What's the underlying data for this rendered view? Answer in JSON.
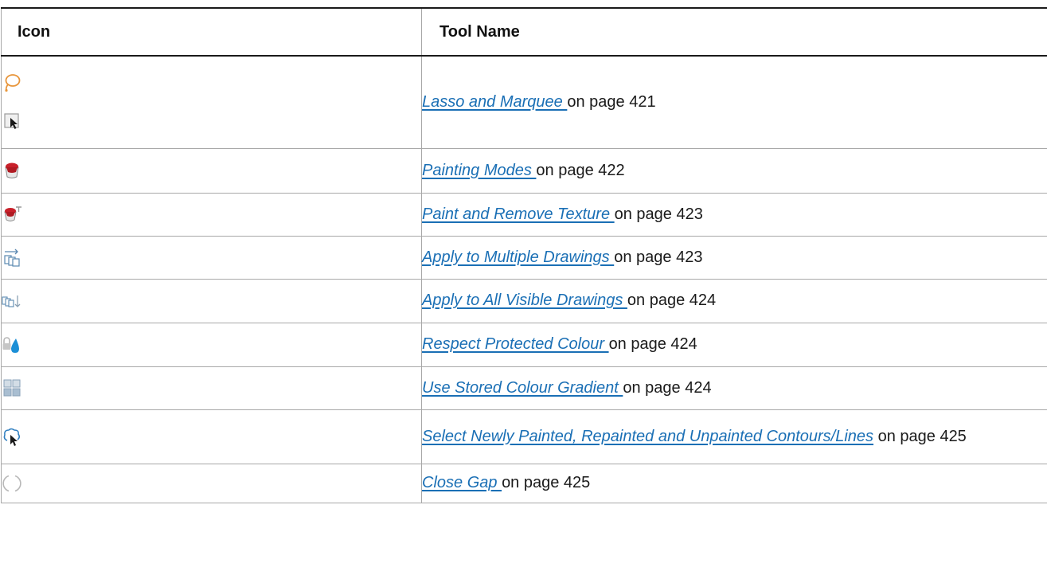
{
  "table": {
    "headers": {
      "icon": "Icon",
      "tool_name": "Tool Name"
    },
    "rows": [
      {
        "icons": [
          "lasso-icon",
          "marquee-icon"
        ],
        "link": "Lasso and Marquee ",
        "suffix": " on page 421"
      },
      {
        "icons": [
          "paint-bucket-icon"
        ],
        "link": "Painting Modes ",
        "suffix": " on page 422"
      },
      {
        "icons": [
          "paint-texture-icon"
        ],
        "link": "Paint and Remove Texture ",
        "suffix": " on page 423"
      },
      {
        "icons": [
          "apply-multiple-drawings-icon"
        ],
        "link": "Apply to Multiple Drawings ",
        "suffix": " on page 423"
      },
      {
        "icons": [
          "apply-all-visible-drawings-icon"
        ],
        "link": "Apply to All Visible Drawings ",
        "suffix": " on page 424"
      },
      {
        "icons": [
          "protected-colour-icon"
        ],
        "link": "Respect Protected Colour ",
        "suffix": " on page 424"
      },
      {
        "icons": [
          "stored-gradient-icon"
        ],
        "link": "Use Stored Colour Gradient ",
        "suffix": " on page 424"
      },
      {
        "icons": [
          "select-painted-contours-icon"
        ],
        "link": "Select Newly Painted, Repainted and Unpainted Contours/Lines",
        "suffix": " on page 425"
      },
      {
        "icons": [
          "close-gap-icon"
        ],
        "link": "Close Gap ",
        "suffix": " on page 425"
      }
    ]
  },
  "colors": {
    "link": "#1a6fb5",
    "paint_red": "#c8202a",
    "drop_blue": "#1c8fd6",
    "lasso_orange": "#e8953a"
  }
}
